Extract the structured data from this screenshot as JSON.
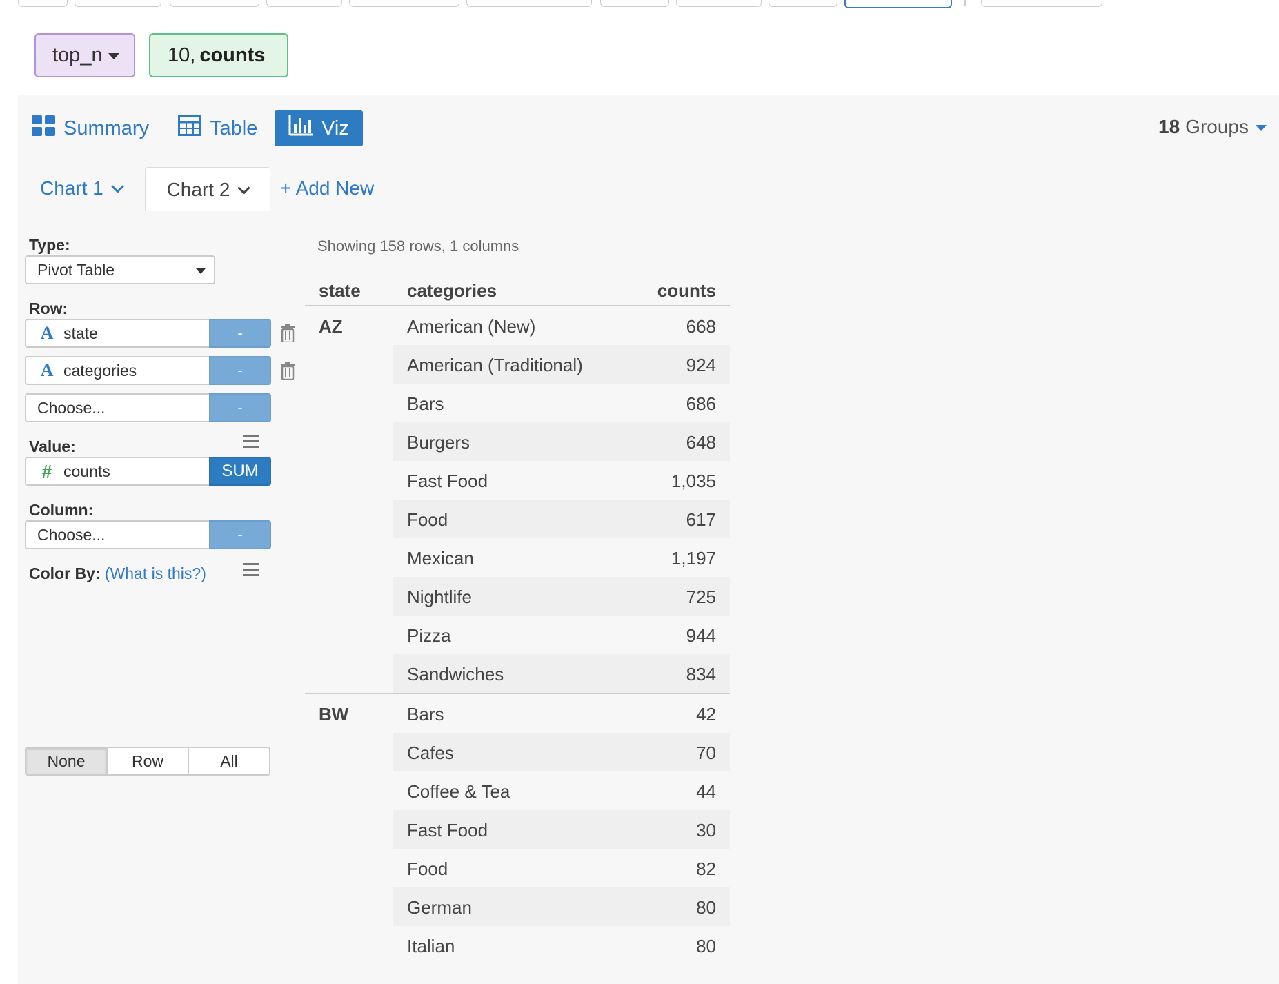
{
  "command": {
    "function": "top_n",
    "args_plain": "10,",
    "args_bold": "counts"
  },
  "views": {
    "summary": "Summary",
    "table": "Table",
    "viz": "Viz",
    "active": "viz"
  },
  "groups": {
    "count": "18",
    "label": "Groups"
  },
  "chart_tabs": {
    "chart1": "Chart 1",
    "chart2": "Chart 2",
    "add_new": "+ Add New"
  },
  "config": {
    "type_label": "Type:",
    "type_value": "Pivot Table",
    "row_label": "Row:",
    "row_fields": [
      {
        "name": "state",
        "agg": "-"
      },
      {
        "name": "categories",
        "agg": "-"
      },
      {
        "name": "Choose...",
        "agg": "-"
      }
    ],
    "value_label": "Value:",
    "value_field": {
      "name": "counts",
      "agg": "SUM"
    },
    "column_label": "Column:",
    "column_field": {
      "name": "Choose...",
      "agg": "-"
    },
    "colorby_label": "Color By:",
    "colorby_help": "(What is this?)",
    "colorby_options": [
      "None",
      "Row",
      "All"
    ],
    "colorby_active": "None"
  },
  "pivot": {
    "summary": "Showing 158 rows, 1 columns",
    "headers": [
      "state",
      "categories",
      "counts"
    ],
    "groups": [
      {
        "state": "AZ",
        "rows": [
          {
            "category": "American (New)",
            "count": "668"
          },
          {
            "category": "American (Traditional)",
            "count": "924"
          },
          {
            "category": "Bars",
            "count": "686"
          },
          {
            "category": "Burgers",
            "count": "648"
          },
          {
            "category": "Fast Food",
            "count": "1,035"
          },
          {
            "category": "Food",
            "count": "617"
          },
          {
            "category": "Mexican",
            "count": "1,197"
          },
          {
            "category": "Nightlife",
            "count": "725"
          },
          {
            "category": "Pizza",
            "count": "944"
          },
          {
            "category": "Sandwiches",
            "count": "834"
          }
        ]
      },
      {
        "state": "BW",
        "rows": [
          {
            "category": "Bars",
            "count": "42"
          },
          {
            "category": "Cafes",
            "count": "70"
          },
          {
            "category": "Coffee & Tea",
            "count": "44"
          },
          {
            "category": "Fast Food",
            "count": "30"
          },
          {
            "category": "Food",
            "count": "82"
          },
          {
            "category": "German",
            "count": "80"
          },
          {
            "category": "Italian",
            "count": "80"
          }
        ]
      }
    ]
  },
  "colors": {
    "accent": "#2d7cc2",
    "link": "#2f7ac7",
    "function_pill": "#ece1f5",
    "arg_pill": "#e2f5e6",
    "number_icon": "#3fa34d"
  }
}
